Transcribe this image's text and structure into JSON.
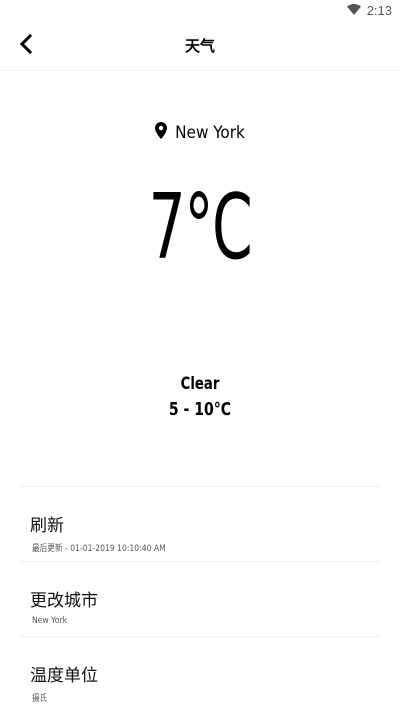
{
  "status_bar": {
    "time": "2:13",
    "icons": [
      "wifi-icon"
    ]
  },
  "toolbar": {
    "back_icon": "chevron-left-icon",
    "title": "天气"
  },
  "weather": {
    "location_icon": "location-pin-icon",
    "city": "New York",
    "temperature": "7°C",
    "condition": "Clear",
    "range": "5 - 10°C"
  },
  "settings": {
    "items": [
      {
        "title": "刷新",
        "subtitle": "最后更新 - 01-01-2019 10:10:40 AM"
      },
      {
        "title": "更改城市",
        "subtitle": "New York"
      },
      {
        "title": "温度单位",
        "subtitle": "摄氏"
      }
    ]
  },
  "colors": {
    "background": "#ffffff",
    "text": "#000000",
    "subtext": "#555555",
    "divider": "#efefef"
  }
}
